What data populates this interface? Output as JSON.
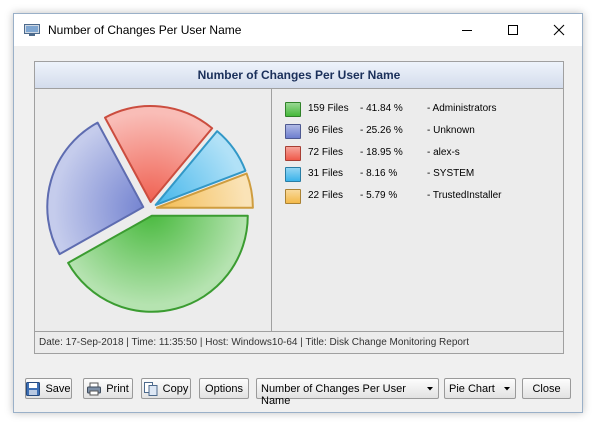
{
  "window": {
    "title": "Number of Changes Per User Name",
    "icon": "disk-monitor-icon"
  },
  "chart": {
    "title": "Number of Changes Per User Name",
    "footer": "Date: 17-Sep-2018 | Time: 11:35:50 | Host: Windows10-64 | Title: Disk Change Monitoring Report"
  },
  "legend": [
    {
      "files": "159 Files",
      "pct": "-  41.84 %",
      "name": "-  Administrators",
      "color": "#45b83a"
    },
    {
      "files": "96 Files",
      "pct": "-  25.26 %",
      "name": "-  Unknown",
      "color": "#6f7fcf"
    },
    {
      "files": "72 Files",
      "pct": "-  18.95 %",
      "name": "-  alex-s",
      "color": "#ef5a4a"
    },
    {
      "files": "31 Files",
      "pct": "-  8.16 %",
      "name": "-  SYSTEM",
      "color": "#3bb3ea"
    },
    {
      "files": "22 Files",
      "pct": "-  5.79 %",
      "name": "-  TrustedInstaller",
      "color": "#f3b94a"
    }
  ],
  "chart_data": {
    "type": "pie",
    "title": "Number of Changes Per User Name",
    "categories": [
      "Administrators",
      "Unknown",
      "alex-s",
      "SYSTEM",
      "TrustedInstaller"
    ],
    "values": [
      159,
      96,
      72,
      31,
      22
    ],
    "percentages": [
      41.84,
      25.26,
      18.95,
      8.16,
      5.79
    ],
    "colors": [
      "#45b83a",
      "#6f7fcf",
      "#ef5a4a",
      "#3bb3ea",
      "#f3b94a"
    ],
    "exploded": true,
    "legend_placement": "right"
  },
  "toolbar": {
    "save_label": "Save",
    "print_label": "Print",
    "copy_label": "Copy",
    "options_label": "Options",
    "report_select": "Number of Changes Per User Name",
    "chart_type_select": "Pie Chart",
    "close_label": "Close"
  }
}
